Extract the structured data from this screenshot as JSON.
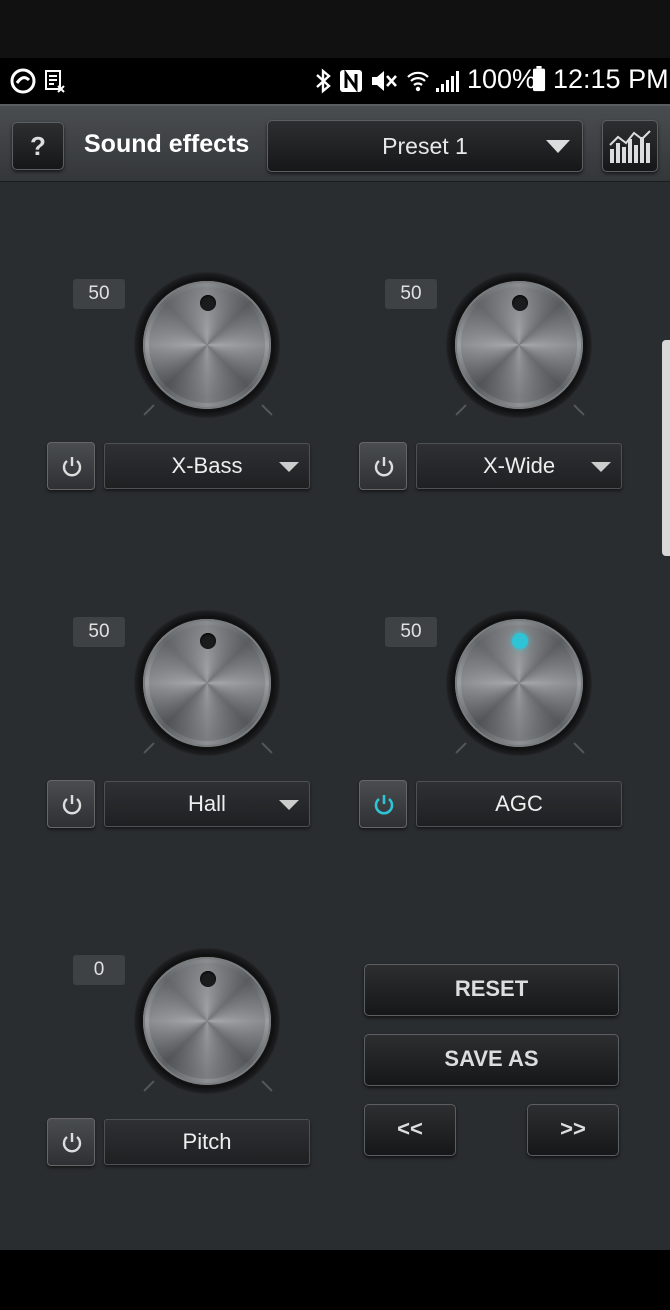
{
  "status_bar": {
    "battery": "100%",
    "time": "12:15 PM"
  },
  "header": {
    "help_label": "?",
    "title": "Sound effects",
    "preset": "Preset 1"
  },
  "effects": [
    {
      "value": "50",
      "label": "X-Bass",
      "enabled": false,
      "has_dropdown": true
    },
    {
      "value": "50",
      "label": "X-Wide",
      "enabled": false,
      "has_dropdown": true
    },
    {
      "value": "50",
      "label": "Hall",
      "enabled": false,
      "has_dropdown": true
    },
    {
      "value": "50",
      "label": "AGC",
      "enabled": true,
      "has_dropdown": false
    },
    {
      "value": "0",
      "label": "Pitch",
      "enabled": false,
      "has_dropdown": false
    }
  ],
  "actions": {
    "reset": "RESET",
    "save_as": "SAVE AS",
    "prev": "<<",
    "next": ">>"
  },
  "colors": {
    "accent": "#2ec4d6",
    "background": "#2a2d30"
  }
}
